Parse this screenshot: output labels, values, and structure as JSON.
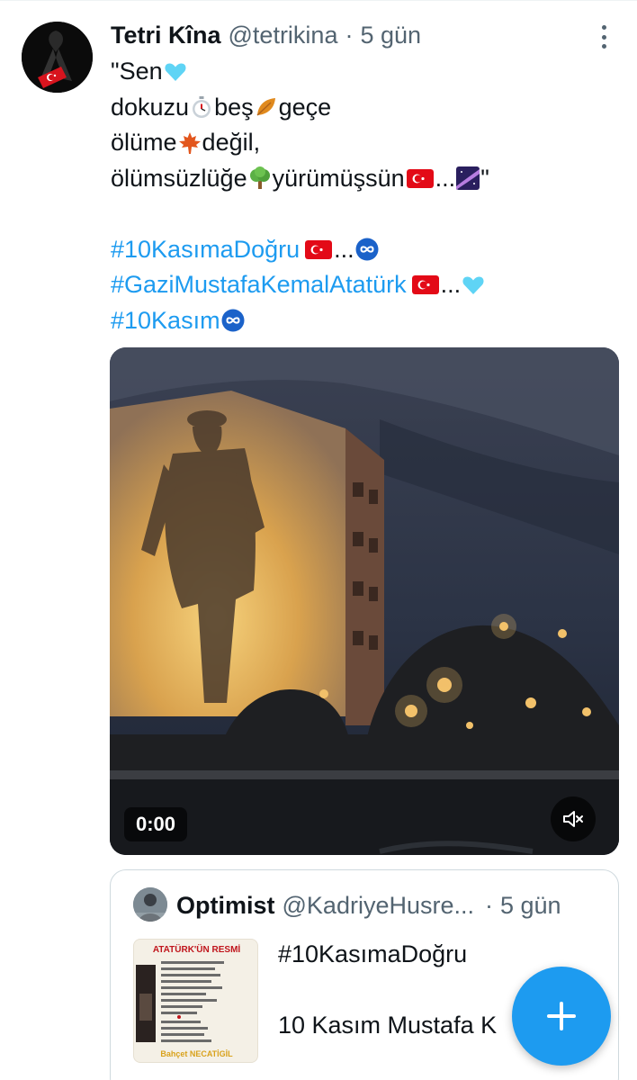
{
  "tweet": {
    "author_name": "Tetri Kîna",
    "author_handle": "@tetrikina",
    "separator": "·",
    "time": "5 gün",
    "lines": [
      "\"Sen",
      "dokuzu",
      "beş",
      "geçe",
      "ölüme",
      "değil,",
      "ölümsüzlüğe",
      "yürümüşsün",
      "...",
      "\""
    ],
    "hashtags": [
      "#10KasımaDoğru",
      "#GaziMustafaKemalAtatürk",
      "#10Kasım"
    ],
    "ellipsis": "..."
  },
  "video": {
    "time": "0:00",
    "icons": [
      "mute-icon"
    ]
  },
  "quote": {
    "author_name": "Optimist",
    "author_handle": "@KadriyeHusre...",
    "separator": "·",
    "time": "5 gün",
    "thumb_title": "ATATÜRK'ÜN RESMİ",
    "thumb_footer": "Bahçet NECATİGİL",
    "text_line1": "#10KasımaDoğru",
    "text_line2": "10 Kasım Mustafa K"
  },
  "icons": [
    "more-icon",
    "plus-icon",
    "blue-heart-icon",
    "stopwatch-icon",
    "fallen-leaf-icon",
    "maple-leaf-icon",
    "tree-icon",
    "turkey-flag-icon",
    "milky-way-icon",
    "infinity-icon"
  ],
  "colors": {
    "accent": "#1d9bf0",
    "text": "#0f1419",
    "secondary": "#536471",
    "border": "#cfd9de"
  }
}
